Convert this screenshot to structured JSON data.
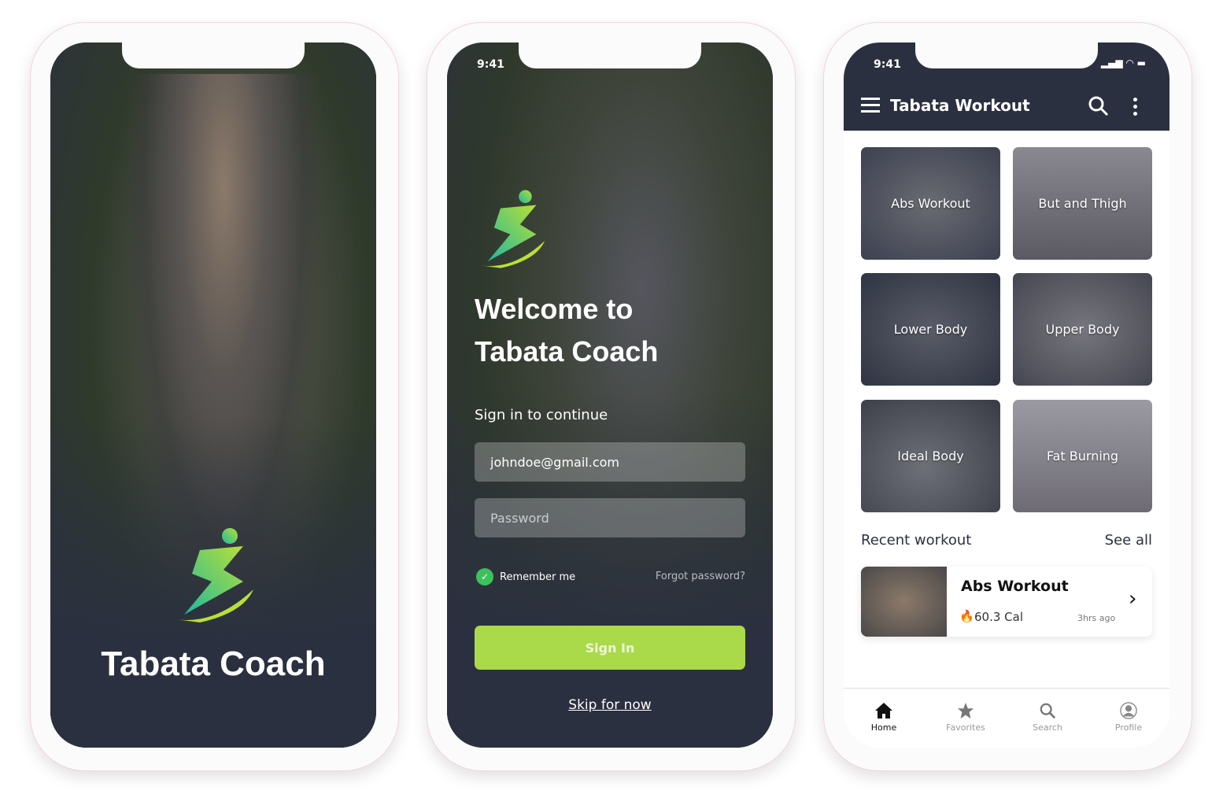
{
  "splash": {
    "title": "Tabata Coach"
  },
  "login": {
    "status_time": "9:41",
    "welcome_line1": "Welcome to",
    "welcome_line2": "Tabata Coach",
    "subtitle": "Sign in to continue",
    "email_value": "johndoe@gmail.com",
    "password_placeholder": "Password",
    "remember_label": "Remember me",
    "remember_checked": true,
    "forgot_label": "Forgot password?",
    "signin_label": "Sign In",
    "skip_label": "Skip for now"
  },
  "home": {
    "status_time": "9:41",
    "header_title": "Tabata Workout",
    "categories": [
      {
        "label": "Abs Workout"
      },
      {
        "label": "But and Thigh"
      },
      {
        "label": "Lower Body"
      },
      {
        "label": "Upper Body"
      },
      {
        "label": "Ideal Body"
      },
      {
        "label": "Fat Burning"
      }
    ],
    "recent_title": "Recent workout",
    "see_all": "See all",
    "recent": {
      "title": "Abs Workout",
      "calories": "60.3 Cal",
      "time": "3hrs ago"
    },
    "nav": [
      {
        "label": "Home",
        "active": true
      },
      {
        "label": "Favorites"
      },
      {
        "label": "Search"
      },
      {
        "label": "Profile"
      }
    ]
  },
  "colors": {
    "dark": "#2b3040",
    "accent": "#aad94a",
    "check": "#3cc15c"
  }
}
